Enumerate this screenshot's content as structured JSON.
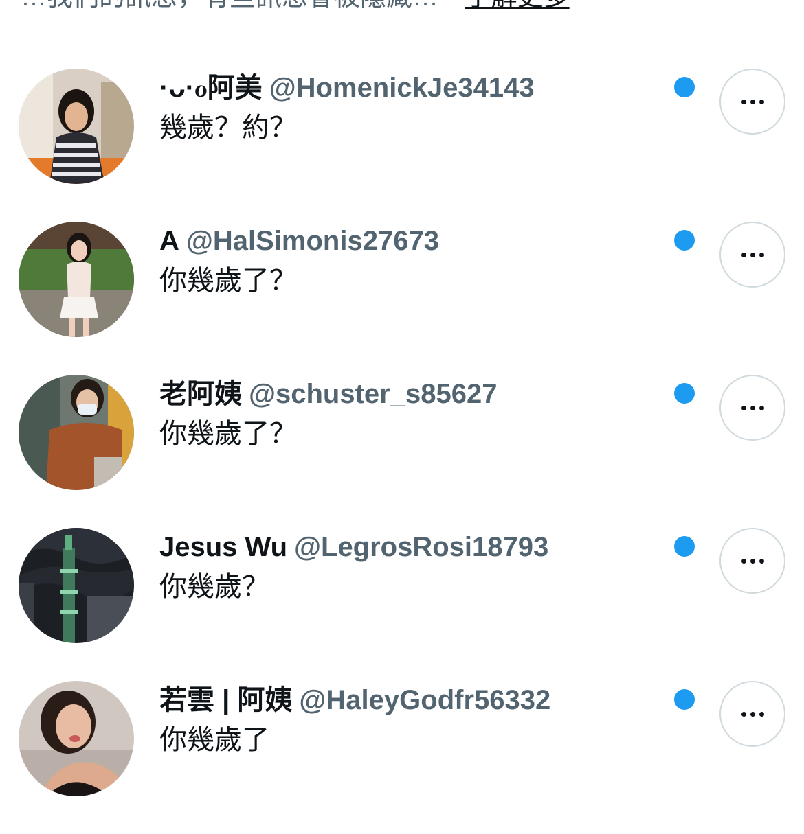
{
  "header": {
    "partial_text": "…我們的訊息，有些訊息會被隱藏…",
    "learn_more_label": "了解更多"
  },
  "conversations": [
    {
      "display_name": "·ᴗ·ℴ阿美",
      "handle": "@HomenickJe34143",
      "message": "幾歲？約？",
      "unread": true
    },
    {
      "display_name": "A",
      "handle": "@HalSimonis27673",
      "message": "你幾歲了？",
      "unread": true
    },
    {
      "display_name": "老阿姨",
      "handle": "@schuster_s85627",
      "message": "你幾歲了？",
      "unread": true
    },
    {
      "display_name": "Jesus Wu",
      "handle": "@LegrosRosi18793",
      "message": "你幾歲？",
      "unread": true
    },
    {
      "display_name": "若雲 | 阿姨",
      "handle": "@HaleyGodfr56332",
      "message": "你幾歲了",
      "unread": true
    }
  ],
  "icons": {
    "more": "more-horizontal-icon",
    "unread": "unread-dot"
  },
  "colors": {
    "unread_dot": "#1d9bf0",
    "handle_text": "#536471",
    "primary_text": "#0f1419",
    "button_border": "#cfd9de"
  }
}
